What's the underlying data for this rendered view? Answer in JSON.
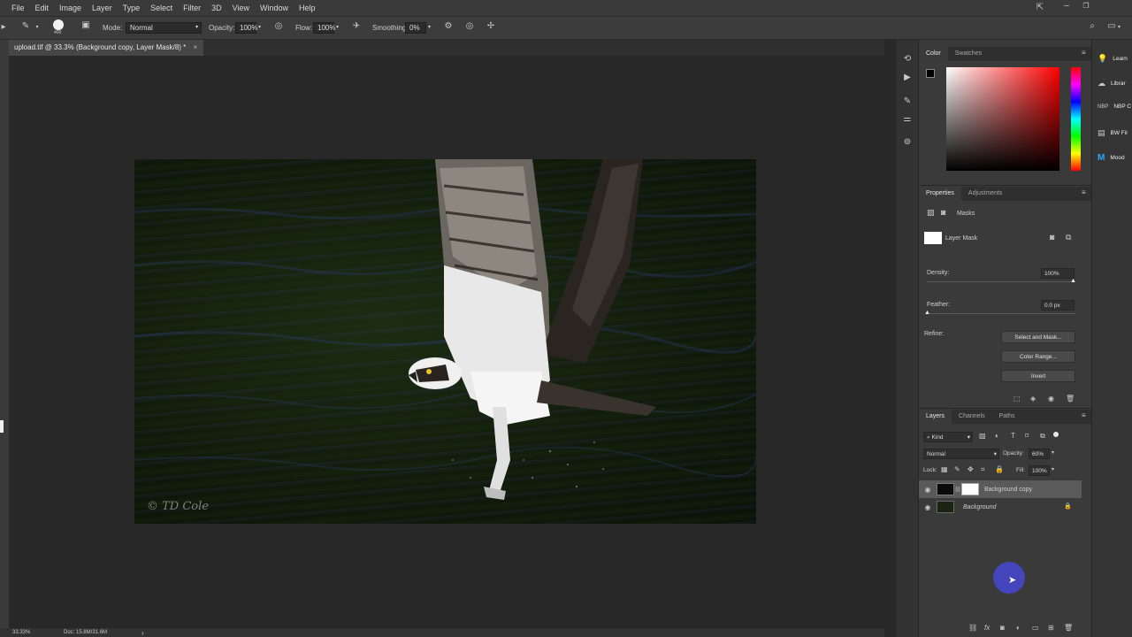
{
  "menu": [
    "File",
    "Edit",
    "Image",
    "Layer",
    "Type",
    "Select",
    "Filter",
    "3D",
    "View",
    "Window",
    "Help"
  ],
  "options": {
    "brush_size": "400",
    "mode_label": "Mode:",
    "mode_value": "Normal",
    "opacity_label": "Opacity:",
    "opacity_value": "100%",
    "flow_label": "Flow:",
    "flow_value": "100%",
    "smoothing_label": "Smoothing:",
    "smoothing_value": "0%"
  },
  "document": {
    "tab_title": "upload.tif @ 33.3% (Background copy, Layer Mask/8) *",
    "close": "×",
    "signature": "© TD Cole"
  },
  "status": {
    "zoom": "33.33%",
    "doc": "Doc: 15.8M/31.6M",
    "arrow": "›"
  },
  "color_panel": {
    "tabs": [
      "Color",
      "Swatches"
    ],
    "hue_accent": "#ff0000"
  },
  "properties_panel": {
    "tabs": [
      "Properties",
      "Adjustments"
    ],
    "masks_label": "Masks",
    "layer_mask_label": "Layer Mask",
    "density_label": "Density:",
    "density_value": "100%",
    "feather_label": "Feather:",
    "feather_value": "0.0 px",
    "refine_label": "Refine:",
    "select_and_mask": "Select and Mask...",
    "color_range": "Color Range...",
    "invert": "Invert"
  },
  "layers_panel": {
    "tabs": [
      "Layers",
      "Channels",
      "Paths"
    ],
    "filter_kind": "Kind",
    "blend_mode": "Normal",
    "opacity_label": "Opacity:",
    "opacity_value": "60%",
    "lock_label": "Lock:",
    "fill_label": "Fill:",
    "fill_value": "100%",
    "layers": [
      {
        "name": "Background copy",
        "selected": true,
        "locked": false
      },
      {
        "name": "Background",
        "selected": false,
        "locked": true
      }
    ]
  },
  "side_panels": [
    {
      "label": "Learn",
      "icon": "lightbulb-icon"
    },
    {
      "label": "Librar",
      "icon": "libraries-icon"
    },
    {
      "label": "NBP C",
      "icon": "nbp-icon"
    },
    {
      "label": "BW Fil",
      "icon": "filter-icon"
    },
    {
      "label": "Mood",
      "icon": "mood-icon"
    }
  ]
}
